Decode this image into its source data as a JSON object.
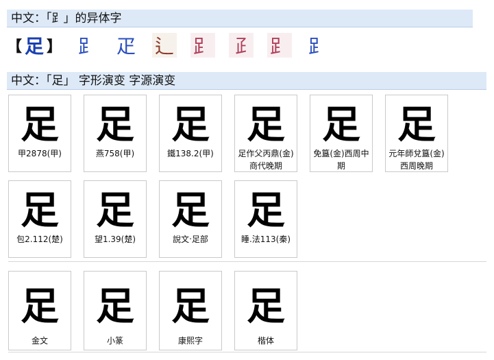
{
  "section1": {
    "title": "中文：「⻊」的异体字",
    "bracket_open": "【",
    "main_char": "足",
    "bracket_close": "】",
    "variants": [
      "⻊",
      "疋",
      "⻍",
      "𧾷",
      "𤴔",
      "𧾷",
      "⻊"
    ]
  },
  "section2": {
    "title": "中文：「足」 字形演变 字源演变",
    "evolution": [
      {
        "glyph": "足",
        "caption": "甲2878(甲)"
      },
      {
        "glyph": "足",
        "caption": "燕758(甲)"
      },
      {
        "glyph": "足",
        "caption": "鐵138.2(甲)"
      },
      {
        "glyph": "足",
        "caption": "足作父丙鼎(金)商代晚期"
      },
      {
        "glyph": "足",
        "caption": "免簋(金)西周中期"
      },
      {
        "glyph": "足",
        "caption": "元年師兌簋(金)西周晚期"
      },
      {
        "glyph": "足",
        "caption": "包2.112(楚)"
      },
      {
        "glyph": "足",
        "caption": "望1.39(楚)"
      },
      {
        "glyph": "足",
        "caption": "說文‧足部"
      },
      {
        "glyph": "足",
        "caption": "睡.法113(秦)"
      }
    ],
    "styles": [
      {
        "glyph": "足",
        "caption": "金文"
      },
      {
        "glyph": "足",
        "caption": "小篆"
      },
      {
        "glyph": "足",
        "caption": "康熙字"
      },
      {
        "glyph": "足",
        "caption": "楷体"
      }
    ]
  },
  "colors": {
    "header_bg": "#dde9f7",
    "main_char": "#1a3fb0"
  }
}
